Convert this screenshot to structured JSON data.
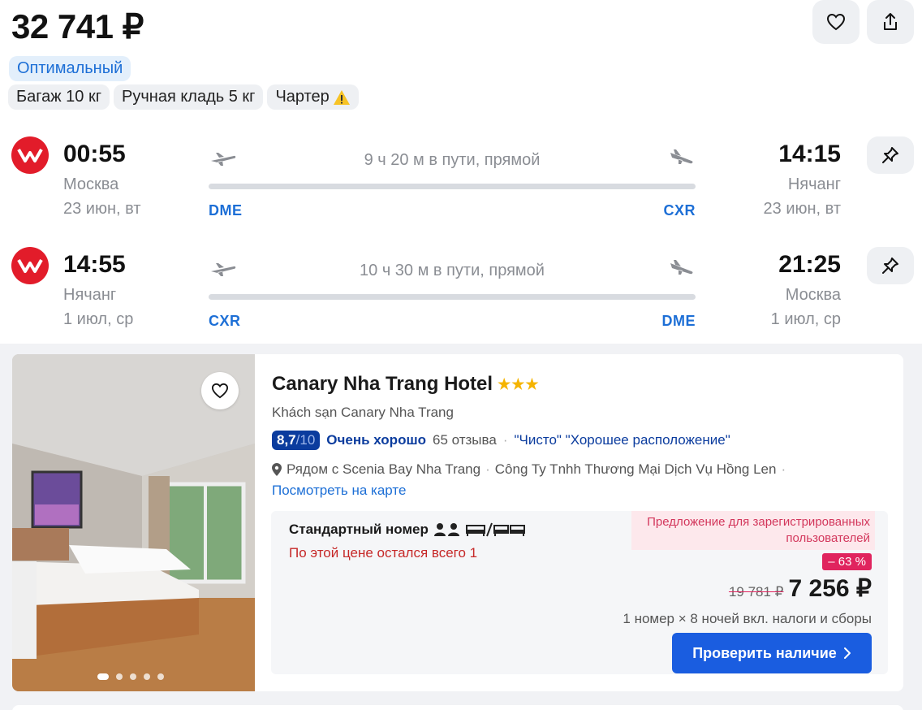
{
  "header": {
    "price": "32 741 ₽",
    "tag_primary": "Оптимальный",
    "tags": [
      "Багаж 10 кг",
      "Ручная кладь 5 кг",
      "Чартер"
    ]
  },
  "flights": [
    {
      "dep_time": "00:55",
      "dep_city": "Москва",
      "dep_date": "23 июн, вт",
      "dep_code": "DME",
      "duration": "9 ч 20 м в пути, прямой",
      "arr_time": "14:15",
      "arr_city": "Нячанг",
      "arr_date": "23 июн, вт",
      "arr_code": "CXR"
    },
    {
      "dep_time": "14:55",
      "dep_city": "Нячанг",
      "dep_date": "1 июл, ср",
      "dep_code": "CXR",
      "duration": "10 ч 30 м в пути, прямой",
      "arr_time": "21:25",
      "arr_city": "Москва",
      "arr_date": "1 июл, ср",
      "arr_code": "DME"
    }
  ],
  "hotel": {
    "name": "Canary Nha Trang Hotel",
    "stars": "★★★",
    "subtitle": "Khách sạn Canary Nha Trang",
    "score": "8,7",
    "score_max": "/10",
    "rating_text": "Очень хорошо",
    "reviews": "65 отзыва",
    "review_tags": "\"Чисто\" \"Хорошее расположение\"",
    "location": "Рядом с Scenia Bay Nha Trang",
    "location_extra": "Công Ty Tnhh Thương Mại Dịch Vụ Hồng Len",
    "map_link": "Посмотреть на карте",
    "room_title": "Стандартный номер",
    "room_left": "По этой цене остался всего 1",
    "promo": "Предложение для зарегистрированных пользователей",
    "discount": "– 63 %",
    "old_price": "19 781 ₽",
    "new_price": "7 256 ₽",
    "nights": "1 номер × 8 ночей вкл. налоги и сборы",
    "cta": "Проверить наличие",
    "photo_count": 5,
    "photo_active": 1
  },
  "colors": {
    "accent": "#1d6fd6",
    "airline_red": "#e21c2a",
    "cta_blue": "#1a5de0",
    "score_navy": "#0b3c9e",
    "discount_pink": "#e0245e"
  }
}
